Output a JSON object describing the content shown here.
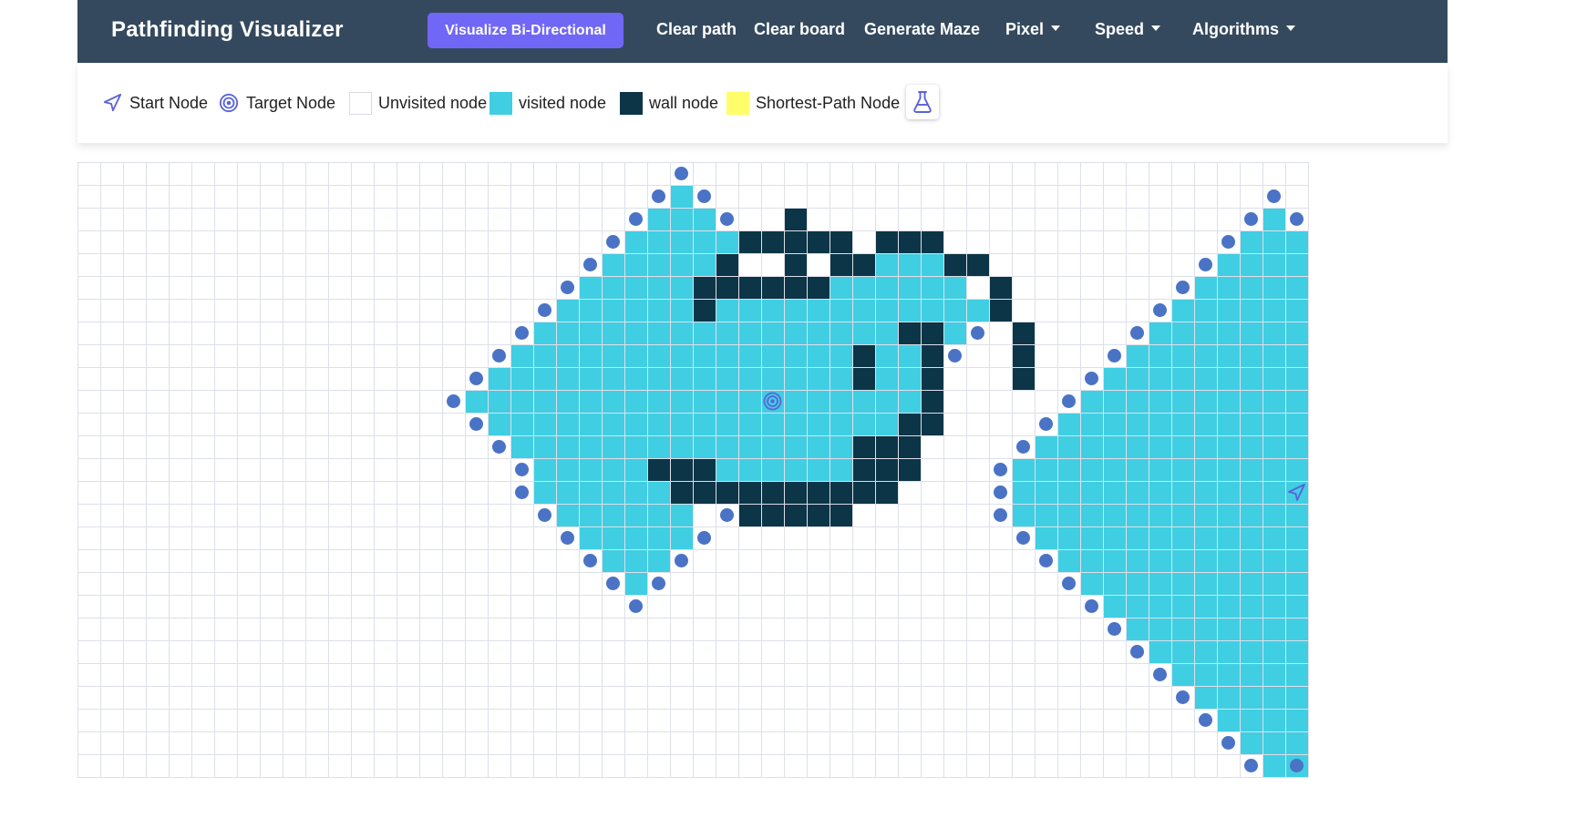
{
  "app": {
    "title": "Pathfinding Visualizer",
    "visualize_label": "Visualize Bi-Directional",
    "colors": {
      "navbar": "#34495e",
      "accent": "#7067f7",
      "visited": "#40cee3",
      "wall": "#0c3547",
      "shortest_path": "#fffe6a",
      "frontier": "#4a73c6",
      "grid_line": "#dde0ea"
    }
  },
  "nav": {
    "items": [
      {
        "label": "Clear path",
        "dropdown": false
      },
      {
        "label": "Clear board",
        "dropdown": false
      },
      {
        "label": "Generate Maze",
        "dropdown": false
      },
      {
        "label": "Pixel",
        "dropdown": true
      },
      {
        "label": "Speed",
        "dropdown": true
      },
      {
        "label": "Algorithms",
        "dropdown": true
      }
    ]
  },
  "legend": {
    "start": "Start Node",
    "target": "Target Node",
    "unvisited": "Unvisited node",
    "visited": "visited node",
    "wall": "wall node",
    "shortest": "Shortest-Path Node",
    "icons": [
      "start-node-icon",
      "target-node-icon",
      "flask-icon"
    ]
  },
  "board": {
    "cols": 54,
    "rows": 27,
    "start": {
      "row": 14,
      "col": 53
    },
    "target": {
      "row": 10,
      "col": 30
    },
    "walls": [
      [
        2,
        31
      ],
      [
        3,
        29,
        33
      ],
      [
        3,
        35,
        37
      ],
      [
        4,
        28
      ],
      [
        4,
        31
      ],
      [
        4,
        33,
        34
      ],
      [
        4,
        38,
        39
      ],
      [
        5,
        27,
        32
      ],
      [
        5,
        40
      ],
      [
        6,
        27
      ],
      [
        6,
        40
      ],
      [
        7,
        36,
        37
      ],
      [
        7,
        41
      ],
      [
        8,
        34
      ],
      [
        8,
        37
      ],
      [
        8,
        41
      ],
      [
        9,
        34
      ],
      [
        9,
        37
      ],
      [
        9,
        41
      ],
      [
        10,
        37
      ],
      [
        11,
        36,
        37
      ],
      [
        12,
        34,
        36
      ],
      [
        13,
        25,
        27
      ],
      [
        13,
        34,
        36
      ],
      [
        14,
        26,
        35
      ],
      [
        15,
        29,
        33
      ]
    ],
    "visited": [
      [
        1,
        26
      ],
      [
        2,
        25,
        27
      ],
      [
        3,
        24,
        28
      ],
      [
        4,
        23,
        27
      ],
      [
        4,
        35,
        37
      ],
      [
        5,
        22,
        26
      ],
      [
        5,
        33,
        38
      ],
      [
        6,
        21,
        26
      ],
      [
        6,
        28,
        39
      ],
      [
        7,
        20,
        35
      ],
      [
        7,
        38
      ],
      [
        8,
        19,
        33
      ],
      [
        8,
        35,
        36
      ],
      [
        9,
        18,
        33
      ],
      [
        9,
        35,
        36
      ],
      [
        10,
        17,
        36
      ],
      [
        11,
        18,
        35
      ],
      [
        12,
        19,
        33
      ],
      [
        13,
        20,
        24
      ],
      [
        13,
        28,
        33
      ],
      [
        14,
        20,
        25
      ],
      [
        15,
        21,
        26
      ],
      [
        16,
        22,
        26
      ],
      [
        17,
        23,
        25
      ],
      [
        18,
        24
      ],
      [
        2,
        52
      ],
      [
        3,
        51,
        53
      ],
      [
        4,
        50,
        53
      ],
      [
        5,
        49,
        53
      ],
      [
        6,
        48,
        53
      ],
      [
        7,
        47,
        53
      ],
      [
        8,
        46,
        53
      ],
      [
        9,
        45,
        53
      ],
      [
        10,
        44,
        53
      ],
      [
        11,
        43,
        53
      ],
      [
        12,
        42,
        53
      ],
      [
        13,
        41,
        53
      ],
      [
        14,
        41,
        53
      ],
      [
        15,
        41,
        53
      ],
      [
        16,
        42,
        53
      ],
      [
        17,
        43,
        53
      ],
      [
        18,
        44,
        53
      ],
      [
        19,
        45,
        53
      ],
      [
        20,
        46,
        53
      ],
      [
        21,
        47,
        53
      ],
      [
        22,
        48,
        53
      ],
      [
        23,
        49,
        53
      ],
      [
        24,
        50,
        53
      ],
      [
        25,
        51,
        53
      ],
      [
        26,
        52,
        53
      ]
    ],
    "frontier": [
      [
        0,
        26
      ],
      [
        1,
        25
      ],
      [
        1,
        27
      ],
      [
        2,
        24
      ],
      [
        2,
        28
      ],
      [
        3,
        23
      ],
      [
        4,
        22
      ],
      [
        5,
        21
      ],
      [
        6,
        20
      ],
      [
        7,
        19
      ],
      [
        7,
        39
      ],
      [
        8,
        18
      ],
      [
        8,
        38
      ],
      [
        9,
        17
      ],
      [
        10,
        16
      ],
      [
        11,
        17
      ],
      [
        12,
        18
      ],
      [
        13,
        19
      ],
      [
        14,
        19
      ],
      [
        15,
        20
      ],
      [
        15,
        28
      ],
      [
        16,
        21
      ],
      [
        16,
        27
      ],
      [
        17,
        22
      ],
      [
        17,
        26
      ],
      [
        18,
        23
      ],
      [
        18,
        25
      ],
      [
        19,
        24
      ],
      [
        1,
        52
      ],
      [
        2,
        51
      ],
      [
        2,
        53
      ],
      [
        3,
        50
      ],
      [
        4,
        49
      ],
      [
        5,
        48
      ],
      [
        6,
        47
      ],
      [
        7,
        46
      ],
      [
        8,
        45
      ],
      [
        9,
        44
      ],
      [
        10,
        43
      ],
      [
        11,
        42
      ],
      [
        12,
        41
      ],
      [
        13,
        40
      ],
      [
        14,
        40
      ],
      [
        15,
        40
      ],
      [
        16,
        41
      ],
      [
        17,
        42
      ],
      [
        18,
        43
      ],
      [
        19,
        44
      ],
      [
        20,
        45
      ],
      [
        21,
        46
      ],
      [
        22,
        47
      ],
      [
        23,
        48
      ],
      [
        24,
        49
      ],
      [
        25,
        50
      ],
      [
        26,
        51
      ],
      [
        26,
        53
      ]
    ]
  }
}
